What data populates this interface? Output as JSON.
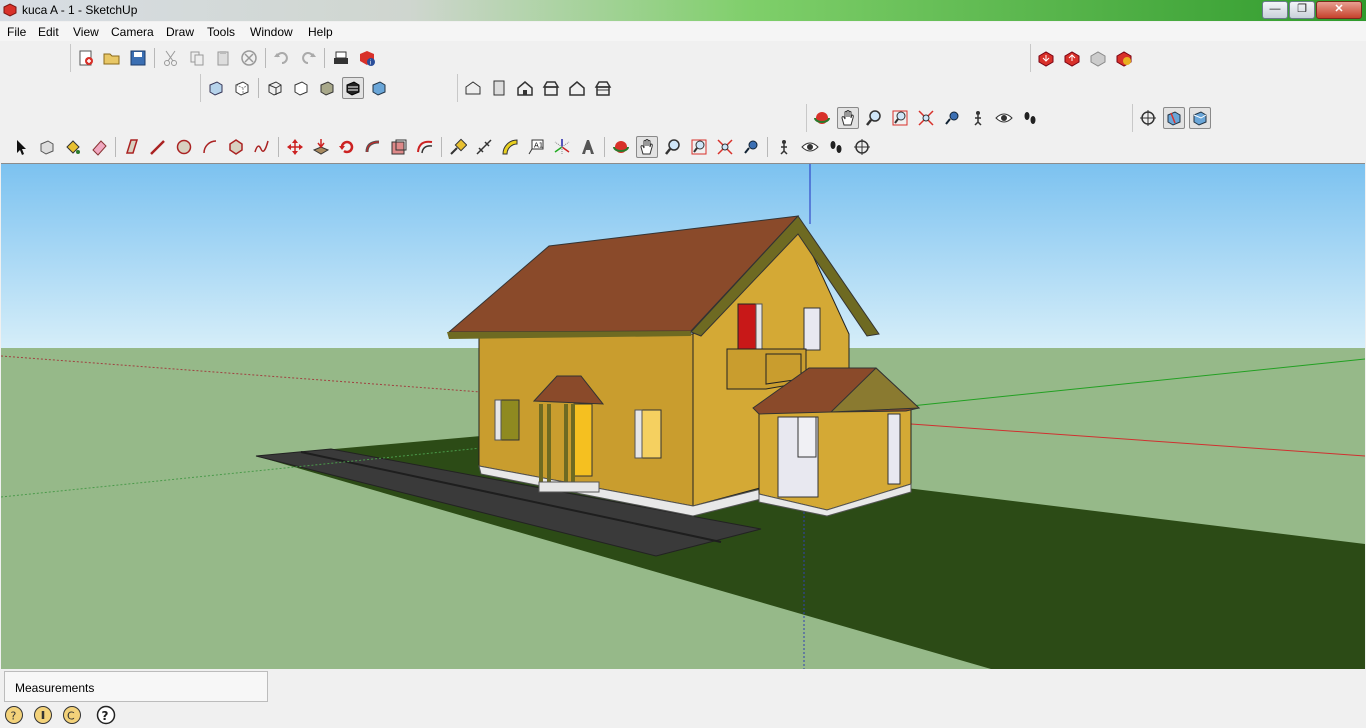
{
  "window": {
    "title": "kuca A - 1 - SketchUp"
  },
  "menu": {
    "items": [
      "File",
      "Edit",
      "View",
      "Camera",
      "Draw",
      "Tools",
      "Window",
      "Help"
    ]
  },
  "window_controls": {
    "minimize": "—",
    "maximize": "❐",
    "close": "✕"
  },
  "toolbars": {
    "standard": [
      "new",
      "open",
      "save",
      "cut",
      "copy",
      "paste",
      "erase",
      "undo",
      "redo",
      "print",
      "model-info"
    ],
    "faces": [
      "xray",
      "back-edges",
      "wireframe",
      "hidden-line",
      "shaded",
      "shaded-textures",
      "monochrome"
    ],
    "views": [
      "iso",
      "top",
      "front",
      "right",
      "back",
      "left"
    ],
    "camera_right": [
      "orbit",
      "pan",
      "zoom",
      "zoom-window",
      "zoom-extents",
      "previous",
      "position-camera",
      "look-around",
      "walk"
    ],
    "sandbox_right": [
      "section-plane",
      "display-sections",
      "section-cuts"
    ],
    "layers_right": [
      "warehouse-get",
      "warehouse-share",
      "components-share",
      "extension-warehouse"
    ],
    "large": [
      "select",
      "make-component",
      "paint-bucket",
      "eraser",
      "rectangle",
      "line",
      "circle",
      "arc",
      "polygon",
      "freehand",
      "move",
      "push-pull",
      "rotate",
      "follow-me",
      "scale",
      "offset",
      "tape-measure",
      "dimension",
      "protractor",
      "text",
      "axes",
      "3d-text",
      "orbit",
      "pan",
      "zoom",
      "zoom-window",
      "zoom-extents",
      "previous",
      "position-camera",
      "look-around",
      "walk",
      "section-plane"
    ]
  },
  "status": {
    "measurements_label": "Measurements"
  },
  "colors": {
    "sky": "#8ecdf5",
    "ground": "#96b989",
    "lawn": "#2c4b16",
    "road": "#3a3a3a",
    "wall": "#c9a030",
    "roof": "#8a4a2a",
    "trim": "#6e6a22"
  }
}
